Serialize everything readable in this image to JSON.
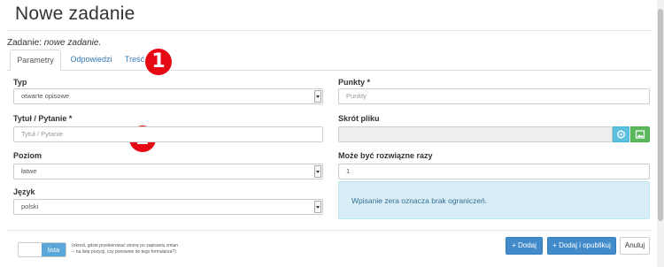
{
  "page": {
    "title": "Nowe zadanie"
  },
  "task": {
    "prefix": "Zadanie:",
    "name": "nowe zadanie."
  },
  "tabs": [
    {
      "label": "Parametry",
      "active": true
    },
    {
      "label": "Odpowiedzi",
      "active": false
    },
    {
      "label": "Treść",
      "active": false
    }
  ],
  "markers": [
    "1",
    "2"
  ],
  "form": {
    "typ": {
      "label": "Typ",
      "value": "otwarte opisowe"
    },
    "tytul": {
      "label": "Tytuł / Pytanie *",
      "placeholder": "Tytuł / Pytanie"
    },
    "poziom": {
      "label": "Poziom",
      "value": "łatwe"
    },
    "jezyk": {
      "label": "Język",
      "value": "polski"
    },
    "punkty": {
      "label": "Punkty *",
      "placeholder": "Punkty"
    },
    "skrot": {
      "label": "Skrót pliku",
      "value": ""
    },
    "rozwiazania": {
      "label": "Może być rozwiązne razy",
      "value": "1"
    },
    "info": "Wpisanie zera oznacza brak ograniczeń."
  },
  "footer": {
    "toggle_label": "lista",
    "toggle_note_1": "(określ, gdzie przekierować stronę po zapisaniu zmian",
    "toggle_note_2": "-- na listę pozycji, czy ponownie do tego formularza?)",
    "add_label": "+ Dodaj",
    "add_publish_label": "+ Dodaj i opublikuj",
    "cancel_label": "Anuluj"
  },
  "colors": {
    "primary": "#428bca",
    "info": "#5bc0de",
    "success": "#5cb85c",
    "marker": "#e50914",
    "alert_bg": "#d9edf7"
  }
}
